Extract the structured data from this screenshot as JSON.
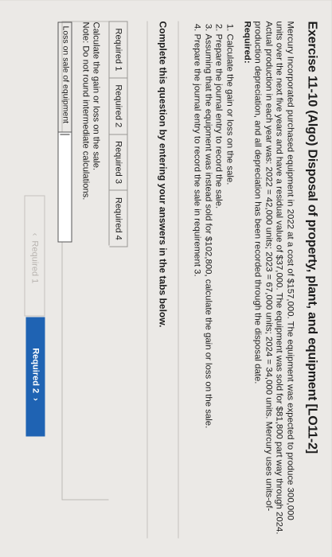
{
  "exercise": {
    "title": "Exercise 11-10 (Algo) Disposal of property, plant, and equipment [LO11-2]",
    "description": "Mercury Incorporated purchased equipment in 2022 at a cost of $157,000. The equipment was expected to produce 300,000 units over the next five years and have a residual value of $37,000. The equipment was sold for $81,800 part way through 2024. Actual production in each year was: 2022 = 42,000 units; 2023 = 67,000 units; 2024 = 34,000 units. Mercury uses units-of-production depreciation, and all depreciation has been recorded through the disposal date.",
    "required_label": "Required:",
    "requirements": [
      "Calculate the gain or loss on the sale.",
      "Prepare the journal entry to record the sale.",
      "Assuming that the equipment was instead sold for $102,800, calculate the gain or loss on the sale.",
      "Prepare the journal entry to record the sale in requirement 3."
    ]
  },
  "instructions": "Complete this question by entering your answers in the tabs below.",
  "tabs": [
    "Required 1",
    "Required 2",
    "Required 3",
    "Required 4"
  ],
  "panel": {
    "line1": "Calculate the gain or loss on the sale.",
    "line2": "Note: Do not round intermediate calculations.",
    "answer_label": "Loss on sale of equipment",
    "answer_value": ""
  },
  "nav": {
    "prev_label": "Required 1",
    "next_label": "Required 2"
  },
  "colors": {
    "primary": "#1f63b3",
    "background": "#ebe9e6"
  }
}
